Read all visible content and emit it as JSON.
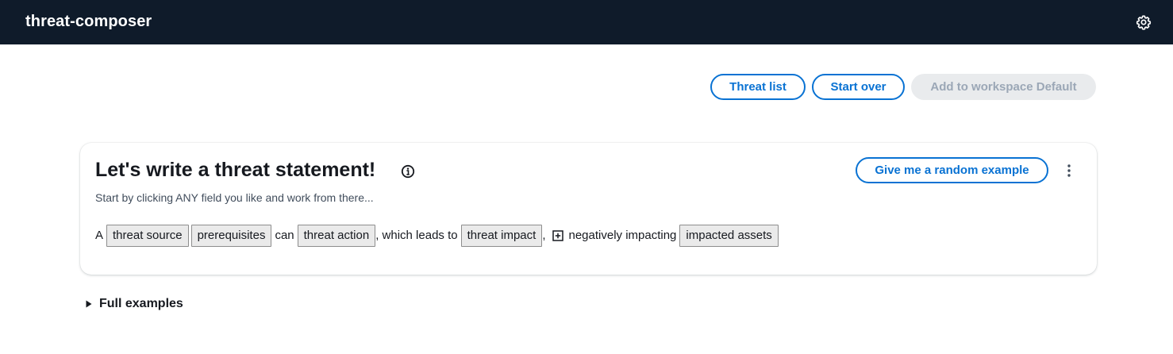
{
  "header": {
    "app_title": "threat-composer",
    "settings_icon": "gear-icon"
  },
  "toolbar": {
    "threat_list_label": "Threat list",
    "start_over_label": "Start over",
    "add_to_workspace_label": "Add to workspace Default"
  },
  "editor": {
    "title": "Let's write a threat statement!",
    "info_icon": "info-icon",
    "subtitle": "Start by clicking ANY field you like and work from there...",
    "random_example_label": "Give me a random example",
    "more_icon": "kebab-menu-icon",
    "statement": {
      "prefix": "A",
      "threat_source": "threat source",
      "prerequisites": "prerequisites",
      "can": "can",
      "threat_action": "threat action",
      "which_leads_to": ", which leads to",
      "threat_impact": "threat impact",
      "comma": ",",
      "add_icon": "plus-square-icon",
      "negatively_impacting": "negatively impacting",
      "impacted_assets": "impacted assets"
    }
  },
  "full_examples": {
    "label": "Full examples",
    "expanded": false
  },
  "colors": {
    "header_bg": "#0f1b2a",
    "accent": "#0972d3",
    "disabled_bg": "#e9ebed",
    "disabled_text": "#9ba7b6"
  }
}
